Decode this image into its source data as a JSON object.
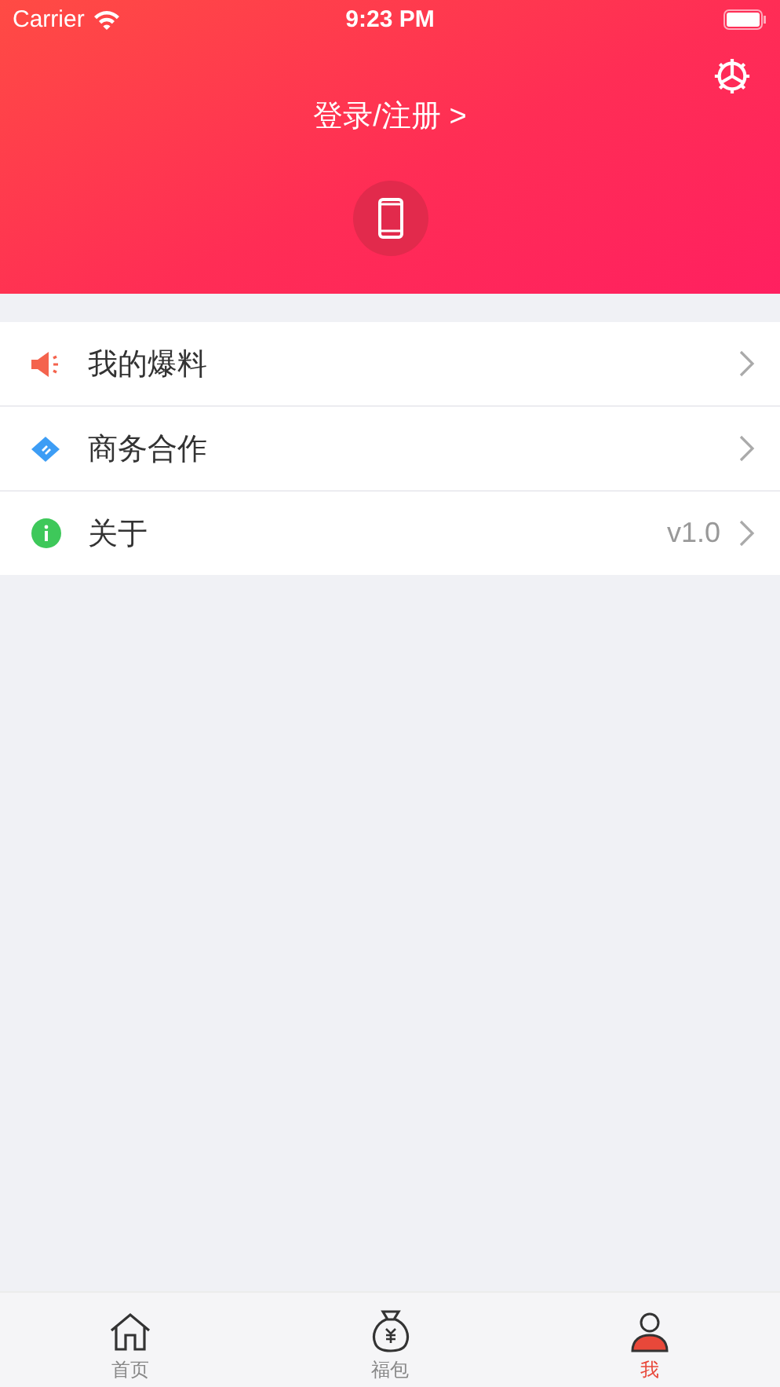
{
  "status_bar": {
    "carrier": "Carrier",
    "time": "9:23 PM"
  },
  "header": {
    "login": "登录/注册 >"
  },
  "menu": [
    {
      "kind": "speaker",
      "label": "我的爆料"
    },
    {
      "kind": "handshake",
      "label": "商务合作"
    },
    {
      "kind": "info",
      "label": "关于",
      "value": "v1.0"
    }
  ],
  "tabs": [
    {
      "kind": "home",
      "label": "首页",
      "selected": false
    },
    {
      "kind": "bag",
      "label": "福包",
      "selected": false
    },
    {
      "kind": "person",
      "label": "我",
      "selected": true
    }
  ]
}
